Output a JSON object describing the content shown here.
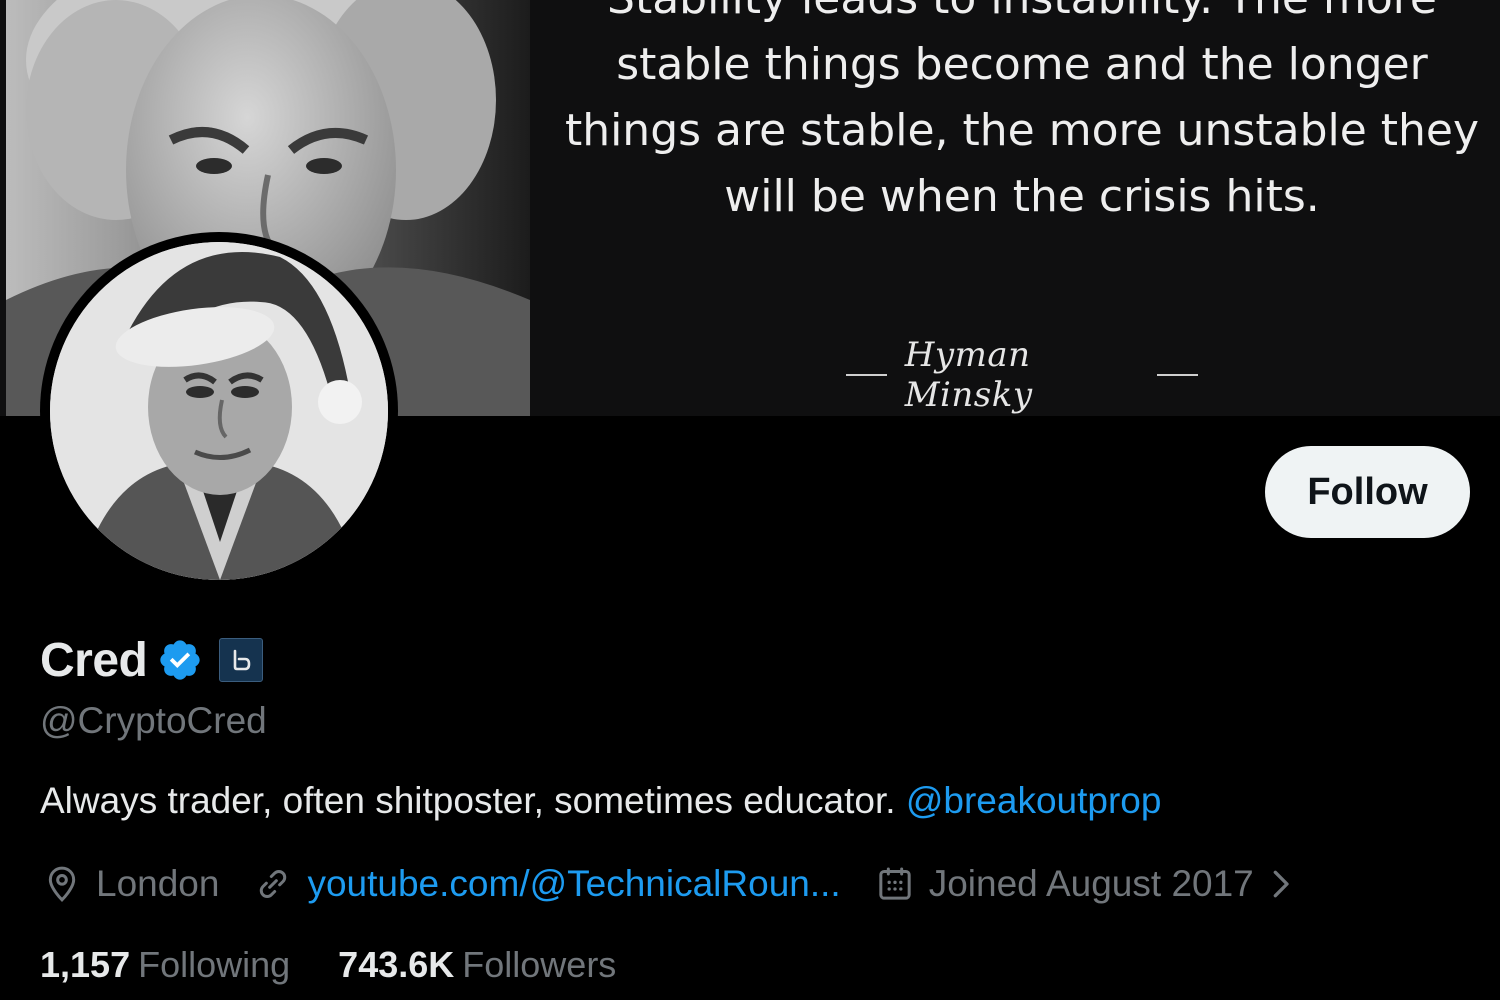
{
  "banner": {
    "quote": "Stability leads to instability. The more stable things become and the longer things are stable, the more unstable they will be when the crisis hits.",
    "author": "Hyman Minsky"
  },
  "profile": {
    "display_name": "Cred",
    "handle": "@CryptoCred",
    "bio_text": "Always trader, often shitposter, sometimes educator.",
    "bio_mention": "@breakoutprop",
    "location": "London",
    "website": "youtube.com/@TechnicalRoun...",
    "joined": "Joined August 2017",
    "following_count": "1,157",
    "following_label": "Following",
    "followers_count": "743.6K",
    "followers_label": "Followers",
    "follow_label": "Follow"
  },
  "icons": {
    "verified": "verified-badge-icon",
    "affiliate": "affiliate-badge-icon",
    "location": "location-pin-icon",
    "link": "link-icon",
    "calendar": "calendar-icon",
    "chevron": "chevron-right-icon"
  },
  "colors": {
    "accent": "#1d9bf0",
    "background": "#000000",
    "secondary_text": "#71767b",
    "primary_text": "#e7e9ea",
    "follow_button_bg": "#eff3f4"
  }
}
